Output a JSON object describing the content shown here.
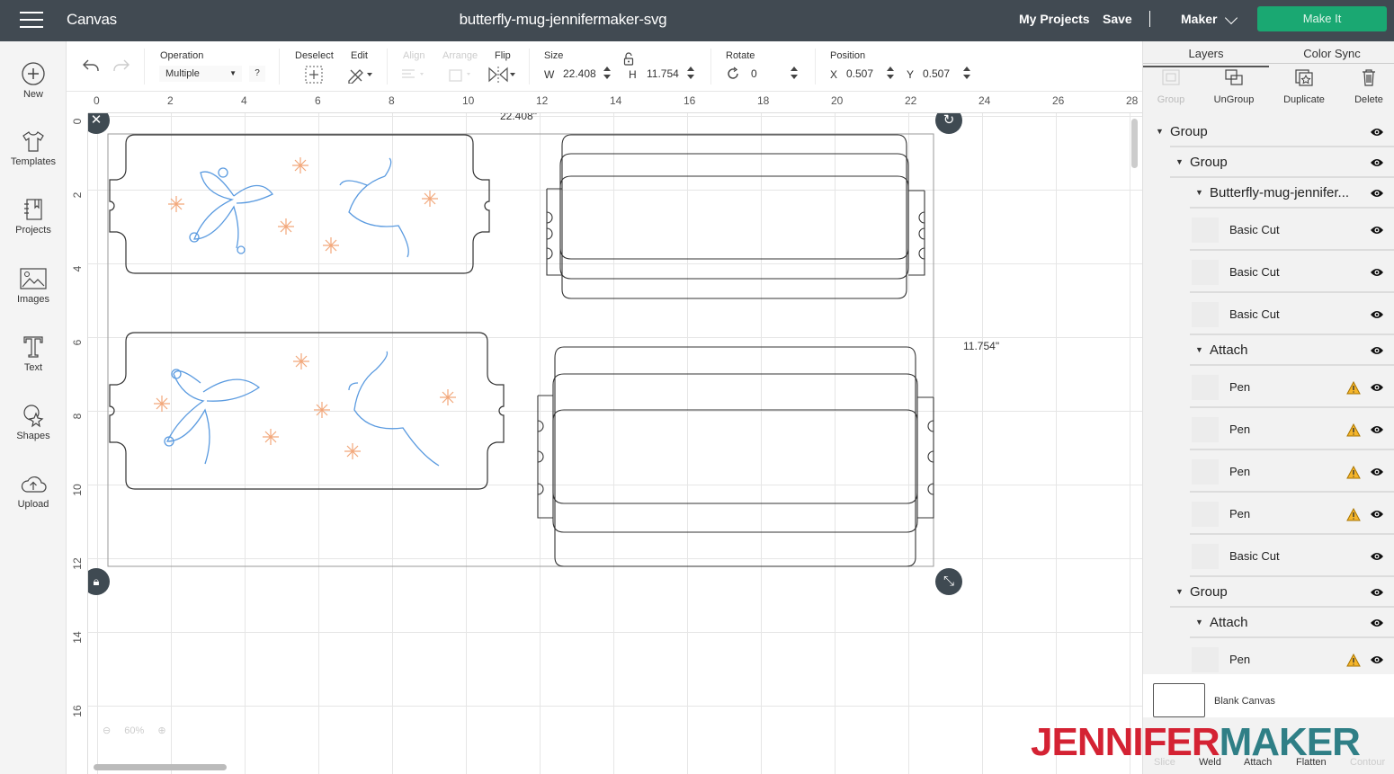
{
  "topbar": {
    "menu_icon": "hamburger-icon",
    "app_title": "Canvas",
    "doc_title": "butterfly-mug-jennifermaker-svg",
    "my_projects": "My Projects",
    "save": "Save",
    "separator": "|",
    "machine": "Maker",
    "make_it": "Make It",
    "make_it_color": "#1aa872"
  },
  "leftnav": {
    "items": [
      {
        "label": "New",
        "icon": "plus-circle-icon"
      },
      {
        "label": "Templates",
        "icon": "tshirt-icon"
      },
      {
        "label": "Projects",
        "icon": "notebook-icon"
      },
      {
        "label": "Images",
        "icon": "image-icon"
      },
      {
        "label": "Text",
        "icon": "text-t-icon"
      },
      {
        "label": "Shapes",
        "icon": "shapes-icon"
      },
      {
        "label": "Upload",
        "icon": "cloud-upload-icon"
      }
    ]
  },
  "toolbar": {
    "operation_label": "Operation",
    "operation_value": "Multiple",
    "help": "?",
    "deselect_label": "Deselect",
    "edit_label": "Edit",
    "align_label": "Align",
    "arrange_label": "Arrange",
    "flip_label": "Flip",
    "size_label": "Size",
    "w_label": "W",
    "w_value": "22.408",
    "h_label": "H",
    "h_value": "11.754",
    "rotate_label": "Rotate",
    "rotate_value": "0",
    "position_label": "Position",
    "x_label": "X",
    "x_value": "0.507",
    "y_label": "Y",
    "y_value": "0.507"
  },
  "rulers": {
    "horizontal": [
      "0",
      "2",
      "4",
      "6",
      "8",
      "10",
      "12",
      "14",
      "16",
      "18",
      "20",
      "22",
      "24",
      "26",
      "28"
    ],
    "vertical": [
      "0",
      "2",
      "4",
      "6",
      "8",
      "10",
      "12",
      "14",
      "16"
    ]
  },
  "canvas": {
    "width_readout": "22.408\"",
    "height_readout": "11.754\"",
    "zoom_level": "60%"
  },
  "panel": {
    "tabs": [
      {
        "label": "Layers",
        "active": true
      },
      {
        "label": "Color Sync",
        "active": false
      }
    ],
    "actions": [
      {
        "label": "Group",
        "enabled": false
      },
      {
        "label": "UnGroup",
        "enabled": true
      },
      {
        "label": "Duplicate",
        "enabled": true
      },
      {
        "label": "Delete",
        "enabled": true
      }
    ],
    "layers": [
      {
        "name": "Group",
        "level": 0,
        "caret": true,
        "warning": false
      },
      {
        "name": "Group",
        "level": 1,
        "caret": true,
        "warning": false
      },
      {
        "name": "Butterfly-mug-jennifer...",
        "level": 2,
        "caret": true,
        "warning": false
      },
      {
        "name": "Basic Cut",
        "level": 3,
        "caret": false,
        "warning": false
      },
      {
        "name": "Basic Cut",
        "level": 3,
        "caret": false,
        "warning": false
      },
      {
        "name": "Basic Cut",
        "level": 3,
        "caret": false,
        "warning": false
      },
      {
        "name": "Attach",
        "level": 2,
        "caret": true,
        "warning": false
      },
      {
        "name": "Pen",
        "level": 3,
        "caret": false,
        "warning": true
      },
      {
        "name": "Pen",
        "level": 3,
        "caret": false,
        "warning": true
      },
      {
        "name": "Pen",
        "level": 3,
        "caret": false,
        "warning": true
      },
      {
        "name": "Pen",
        "level": 3,
        "caret": false,
        "warning": true
      },
      {
        "name": "Basic Cut",
        "level": 3,
        "caret": false,
        "warning": false
      },
      {
        "name": "Group",
        "level": 1,
        "caret": true,
        "warning": false
      },
      {
        "name": "Attach",
        "level": 2,
        "caret": true,
        "warning": false
      },
      {
        "name": "Pen",
        "level": 3,
        "caret": false,
        "warning": true
      }
    ],
    "blank_canvas": "Blank Canvas",
    "bottom_tools": [
      {
        "label": "Slice",
        "enabled": false
      },
      {
        "label": "Weld",
        "enabled": true
      },
      {
        "label": "Attach",
        "enabled": true
      },
      {
        "label": "Flatten",
        "enabled": true
      },
      {
        "label": "Contour",
        "enabled": false
      }
    ]
  },
  "watermark": {
    "part1": "JENNIFER",
    "part2": "MAKER",
    "color1": "#d42233",
    "color2": "#2f7f86"
  }
}
